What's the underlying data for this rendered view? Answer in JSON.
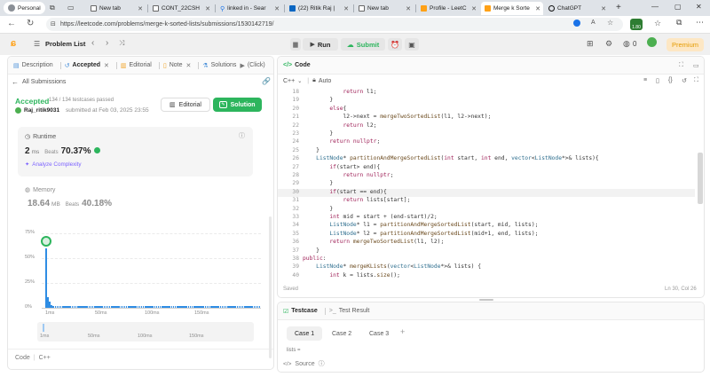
{
  "browser": {
    "profile": "Personal",
    "tabs": [
      {
        "label": "New tab",
        "color": "#5f6368"
      },
      {
        "label": "CONT_22CSH",
        "color": "#5f6368"
      },
      {
        "label": "linked in - Sear",
        "color": "#1a73e8"
      },
      {
        "label": "(22) Ritik Raj |",
        "color": "#0a66c2"
      },
      {
        "label": "New tab",
        "color": "#5f6368"
      },
      {
        "label": "Profile - LeetC",
        "color": "#ffa116"
      },
      {
        "label": "Merge k Sorte",
        "color": "#ffa116"
      },
      {
        "label": "ChatGPT",
        "color": "#111111"
      }
    ],
    "url": "https://leetcode.com/problems/merge-k-sorted-lists/submissions/1530142719/",
    "badge": "1.80"
  },
  "header": {
    "problem_list": "Problem List",
    "run": "Run",
    "submit": "Submit",
    "streak": "0",
    "premium": "Premium"
  },
  "left": {
    "tabs": [
      "Description",
      "Accepted",
      "Editorial",
      "Note",
      "Solutions",
      "(Click)"
    ],
    "all_submissions": "All Submissions",
    "status": "Accepted",
    "testcases": "134 / 134 testcases passed",
    "user": "Raj_ritik9031",
    "submitted": "submitted at Feb 03, 2025 23:55",
    "editorial_btn": "Editorial",
    "solution_btn": "Solution",
    "runtime_label": "Runtime",
    "runtime_value": "2",
    "runtime_unit": "ms",
    "beats_label": "Beats",
    "runtime_beats": "70.37%",
    "analyze": "Analyze Complexity",
    "memory_label": "Memory",
    "memory_value": "18.64",
    "memory_unit": "MB",
    "memory_beats": "40.18%",
    "footer_lang": "Code",
    "footer_lang2": "C++"
  },
  "chart_data": {
    "type": "bar",
    "y_ticks": [
      "75%",
      "50%",
      "25%",
      "0%"
    ],
    "x_ticks": [
      "1ms",
      "50ms",
      "100ms",
      "150ms"
    ],
    "mini_ticks": [
      "1ms",
      "50ms",
      "100ms",
      "150ms"
    ],
    "highlight_index": 0,
    "values": [
      60,
      11,
      6,
      3,
      2,
      2,
      1.5,
      1.5,
      1.5,
      1.5,
      1.5,
      1.5,
      1.5,
      1.5,
      1.5,
      1.5,
      1.5,
      1.5,
      1.5,
      1.5,
      1.5,
      1.5,
      1.5,
      1.5,
      1.5,
      1.5,
      1.5,
      1.5,
      1.5,
      1.5,
      1.5,
      1.5,
      1.5,
      1.5,
      1.5,
      1.5,
      1.5,
      1.5,
      1.5,
      1.5,
      1.5,
      1.5,
      1.5,
      1.5,
      1.5,
      1.5,
      1.5,
      1.5,
      1.5,
      1.5,
      1.5,
      1.5,
      1.5,
      1.5,
      1.5,
      1.5,
      1.5,
      1.5,
      1.5,
      1.5,
      1.5,
      1.5,
      1.5,
      1.5,
      1.5,
      1.5,
      1.5,
      1.5,
      1.5,
      1.5,
      1.5,
      1.5,
      1.5,
      1.5,
      1.5,
      1.5,
      1.5,
      1.5,
      1.5,
      1.5,
      1.5,
      1.5,
      1.5,
      1.5,
      1.5,
      1.5,
      1.5,
      1.5,
      1.5,
      1.5,
      1.5,
      1.5,
      1.5,
      1.5,
      1.5,
      1.5,
      1.5,
      1.5,
      1.5,
      1.5,
      1.5,
      1.5,
      1.5,
      1.5,
      1.5,
      1.5,
      1.5,
      1.5,
      1.5,
      1.5,
      1.5,
      1.5,
      1.5,
      1.5,
      1.5
    ],
    "ylim": [
      0,
      75
    ]
  },
  "editor": {
    "title": "Code",
    "language": "C++",
    "mode": "Auto",
    "saved": "Saved",
    "position": "Ln 30, Col 26",
    "lines": [
      {
        "n": "18",
        "t": "            return l1;"
      },
      {
        "n": "19",
        "t": "        }"
      },
      {
        "n": "20",
        "t": "        else{"
      },
      {
        "n": "21",
        "t": "            l2->next = mergeTwoSortedList(l1, l2->next);"
      },
      {
        "n": "22",
        "t": "            return l2;"
      },
      {
        "n": "23",
        "t": "        }"
      },
      {
        "n": "24",
        "t": "        return nullptr;"
      },
      {
        "n": "25",
        "t": "    }"
      },
      {
        "n": "26",
        "t": "    ListNode* partitionAndMergeSortedList(int start, int end, vector<ListNode*>& lists){"
      },
      {
        "n": "27",
        "t": "        if(start> end){"
      },
      {
        "n": "28",
        "t": "            return nullptr;"
      },
      {
        "n": "29",
        "t": "        }"
      },
      {
        "n": "30",
        "t": "        if(start == end){"
      },
      {
        "n": "31",
        "t": "            return lists[start];"
      },
      {
        "n": "32",
        "t": "        }"
      },
      {
        "n": "33",
        "t": "        int mid = start + (end-start)/2;"
      },
      {
        "n": "34",
        "t": "        ListNode* l1 = partitionAndMergeSortedList(start, mid, lists);"
      },
      {
        "n": "35",
        "t": "        ListNode* l2 = partitionAndMergeSortedList(mid+1, end, lists);"
      },
      {
        "n": "36",
        "t": "        return mergeTwoSortedList(l1, l2);"
      },
      {
        "n": "37",
        "t": "    }"
      },
      {
        "n": "38",
        "t": "public:"
      },
      {
        "n": "39",
        "t": "    ListNode* mergeKLists(vector<ListNode*>& lists) {"
      },
      {
        "n": "40",
        "t": "        int k = lists.size();"
      }
    ]
  },
  "testcase": {
    "tab1": "Testcase",
    "tab2": "Test Result",
    "cases": [
      "Case 1",
      "Case 2",
      "Case 3"
    ],
    "var_label": "lists =",
    "source": "Source"
  }
}
